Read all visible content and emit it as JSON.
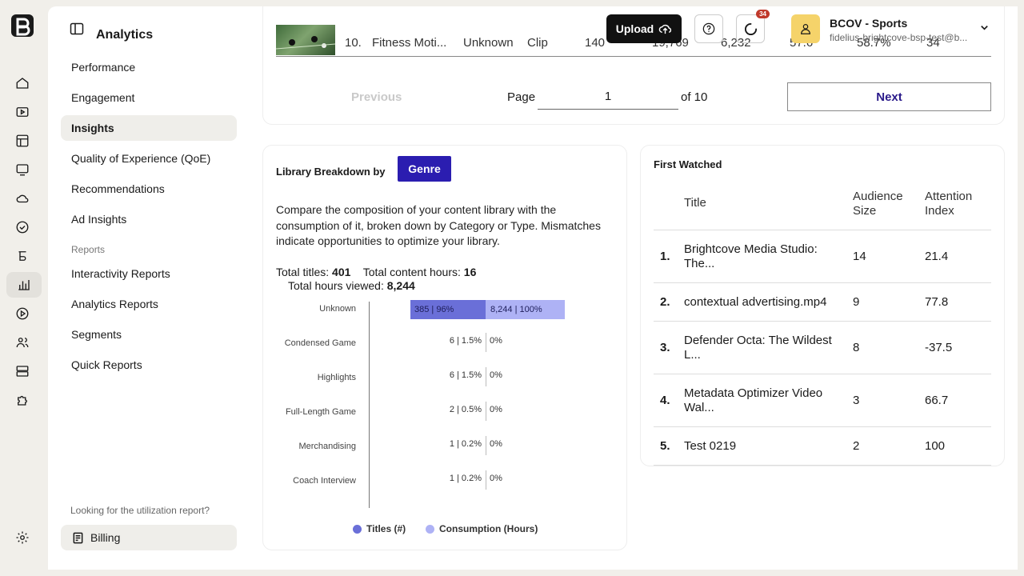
{
  "app": {
    "page_title": "Analytics",
    "rail_icons": [
      "logo-icon",
      "home-icon",
      "video-icon",
      "layout-icon",
      "monitor-icon",
      "cloud-icon",
      "shield-check-icon",
      "brand-icon",
      "analytics-icon",
      "play-icon",
      "users-icon",
      "server-icon",
      "puzzle-icon",
      "settings-icon"
    ]
  },
  "sidebar": {
    "items": [
      {
        "label": "Performance"
      },
      {
        "label": "Engagement"
      },
      {
        "label": "Insights",
        "active": true
      },
      {
        "label": "Quality of Experience (QoE)"
      },
      {
        "label": "Recommendations"
      },
      {
        "label": "Ad Insights"
      }
    ],
    "section_label": "Reports",
    "report_items": [
      {
        "label": "Interactivity Reports"
      },
      {
        "label": "Analytics Reports"
      },
      {
        "label": "Segments"
      },
      {
        "label": "Quick Reports"
      }
    ],
    "util_note": "Looking for the utilization report?",
    "billing_label": "Billing"
  },
  "header": {
    "upload_label": "Upload",
    "notification_count": "34",
    "account_name": "BCOV - Sports",
    "account_email": "fidelius-brightcove-bsp-test@b..."
  },
  "top_table": {
    "row": {
      "rank": "10.",
      "title": "Fitness Moti...",
      "col3": "Unknown",
      "col4": "Clip",
      "col5": "140",
      "col6": "19,769",
      "col7": "6,232",
      "col8": "57.6",
      "col9": "58.7%",
      "col10": "34"
    },
    "pager": {
      "prev_label": "Previous",
      "page_label": "Page",
      "page_value": "1",
      "of_label": "of 10",
      "next_label": "Next"
    }
  },
  "library": {
    "title": "Library Breakdown by",
    "genre_button": "Genre",
    "description": "Compare the composition of your content library with the consumption of it, broken down by Category or Type. Mismatches indicate opportunities to optimize your library.",
    "totals": {
      "titles_label": "Total titles:",
      "titles_value": "401",
      "content_hours_label": "Total content hours:",
      "content_hours_value": "16",
      "hours_viewed_label": "Total hours viewed:",
      "hours_viewed_value": "8,244"
    },
    "legend": {
      "titles": "Titles (#)",
      "consumption": "Consumption (Hours)"
    },
    "colors": {
      "titles": "#6a6fd8",
      "consumption": "#aeb2f5"
    }
  },
  "chart_data": {
    "type": "bar",
    "orientation": "horizontal-diverging",
    "categories": [
      "Unknown",
      "Condensed Game",
      "Highlights",
      "Full-Length Game",
      "Merchandising",
      "Coach Interview"
    ],
    "series": [
      {
        "name": "Titles (#)",
        "values": [
          385,
          6,
          6,
          2,
          1,
          1
        ],
        "percent": [
          96,
          1.5,
          1.5,
          0.5,
          0.2,
          0.2
        ],
        "labels": [
          "385 | 96%",
          "6 | 1.5%",
          "6 | 1.5%",
          "2 | 0.5%",
          "1 | 0.2%",
          "1 | 0.2%"
        ]
      },
      {
        "name": "Consumption (Hours)",
        "values": [
          8244,
          0,
          0,
          0,
          0,
          0
        ],
        "percent": [
          100,
          0,
          0,
          0,
          0,
          0
        ],
        "labels": [
          "8,244 | 100%",
          "0%",
          "0%",
          "0%",
          "0%",
          "0%"
        ]
      }
    ],
    "legend_position": "bottom"
  },
  "first_watched": {
    "title": "First Watched",
    "headers": {
      "title": "Title",
      "audience": "Audience Size",
      "attention": "Attention Index"
    },
    "rows": [
      {
        "rank": "1.",
        "title": "Brightcove Media Studio: The...",
        "audience": "14",
        "attention": "21.4"
      },
      {
        "rank": "2.",
        "title": "contextual advertising.mp4",
        "audience": "9",
        "attention": "77.8"
      },
      {
        "rank": "3.",
        "title": "Defender Octa: The Wildest L...",
        "audience": "8",
        "attention": "-37.5"
      },
      {
        "rank": "4.",
        "title": "Metadata Optimizer Video Wal...",
        "audience": "3",
        "attention": "66.7"
      },
      {
        "rank": "5.",
        "title": "Test 0219",
        "audience": "2",
        "attention": "100"
      }
    ]
  }
}
